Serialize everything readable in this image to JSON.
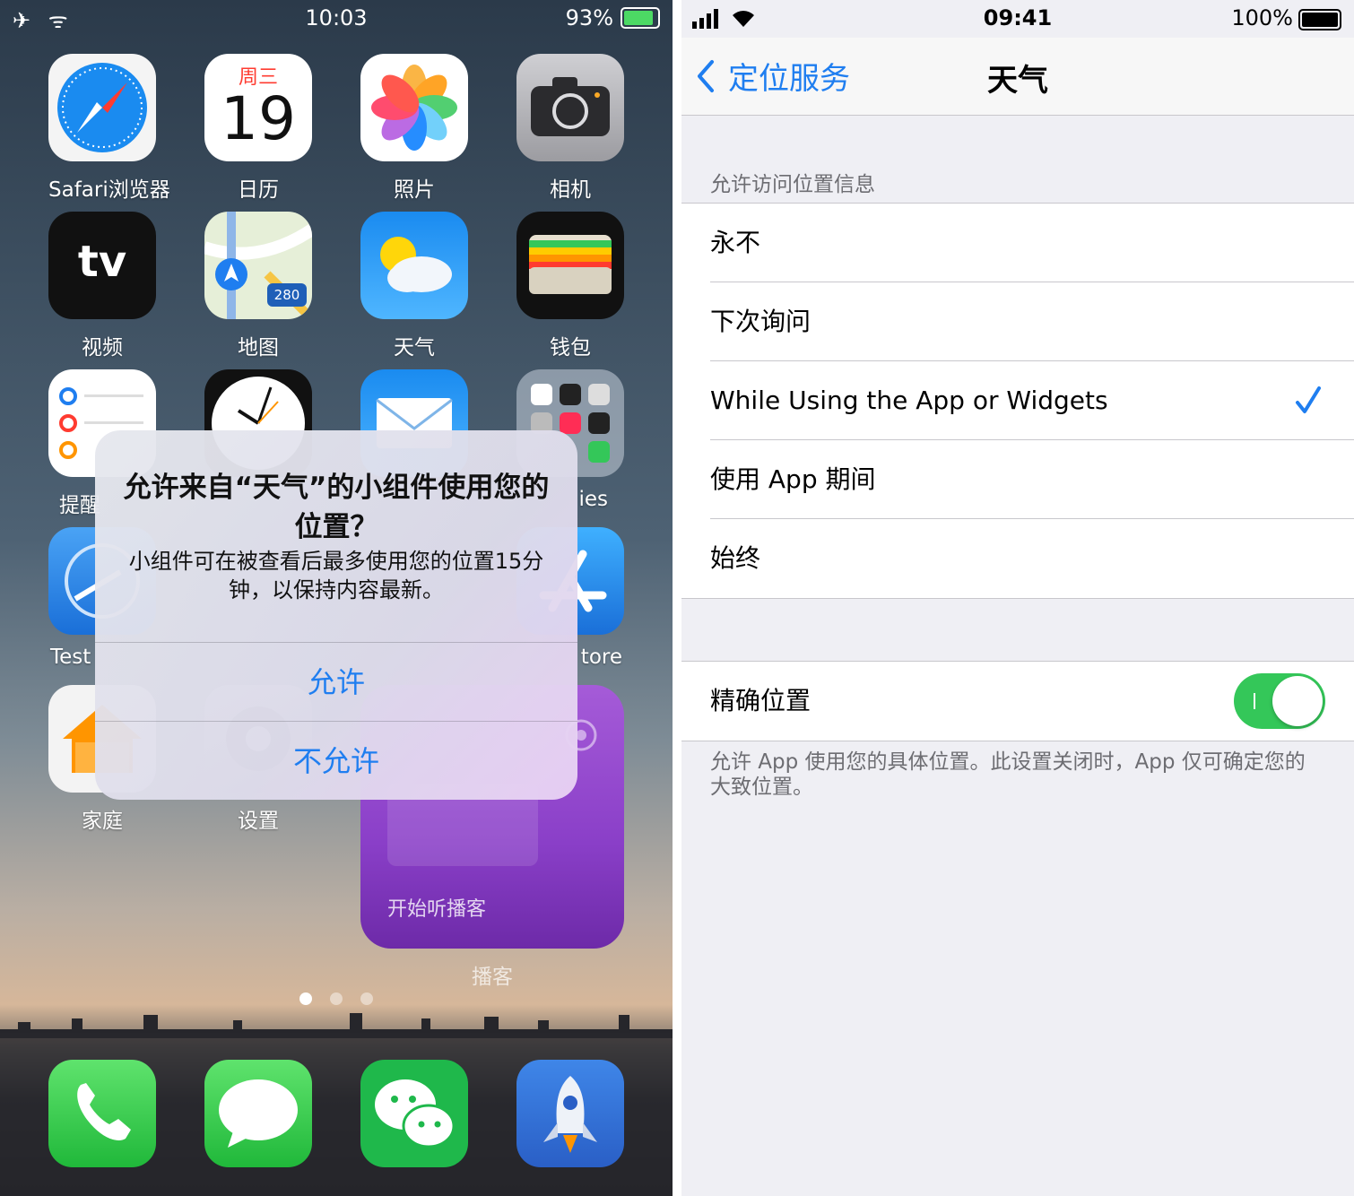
{
  "left_screen": {
    "status_bar": {
      "time": "10:03",
      "battery_percent": "93%",
      "left_icons": "✈ ᯤ"
    },
    "apps": {
      "safari": "Safari浏览器",
      "calendar": "日历",
      "calendar_day_name": "周三",
      "calendar_day": "19",
      "photos": "照片",
      "camera": "相机",
      "tv": "视频",
      "tv_logo": "tv",
      "maps": "地图",
      "maps_shield": "280",
      "weather": "天气",
      "wallet": "钱包",
      "reminders_partial": "提醒",
      "utilities_partial": "ies",
      "testflight_partial": "Test",
      "appstore_partial": "tore",
      "home": "家庭",
      "settings": "设置",
      "podcast_widget_text": "开始听播客",
      "podcasts": "播客"
    },
    "alert": {
      "title": "允许来自“天气”的小组件使用您的位置？",
      "message": "小组件可在被查看后最多使用您的位置15分钟，以保持内容最新。",
      "allow_label": "允许",
      "deny_label": "不允许"
    },
    "page_indicator": {
      "pages": 3,
      "current": 1
    }
  },
  "right_screen": {
    "status_bar": {
      "time": "09:41",
      "battery_percent": "100%"
    },
    "nav": {
      "back_label": "定位服务",
      "title": "天气"
    },
    "section_header": "允许访问位置信息",
    "options": [
      {
        "label": "永不",
        "selected": false
      },
      {
        "label": "下次询问",
        "selected": false
      },
      {
        "label": "While Using the App or Widgets",
        "selected": true
      },
      {
        "label": "使用 App 期间",
        "selected": false
      },
      {
        "label": "始终",
        "selected": false
      }
    ],
    "precise": {
      "label": "精确位置",
      "enabled": true
    },
    "footer": "允许 App 使用您的具体位置。此设置关闭时，App 仅可确定您的大致位置。"
  },
  "colors": {
    "ios_blue": "#1f7ef0",
    "toggle_green": "#34c759"
  }
}
